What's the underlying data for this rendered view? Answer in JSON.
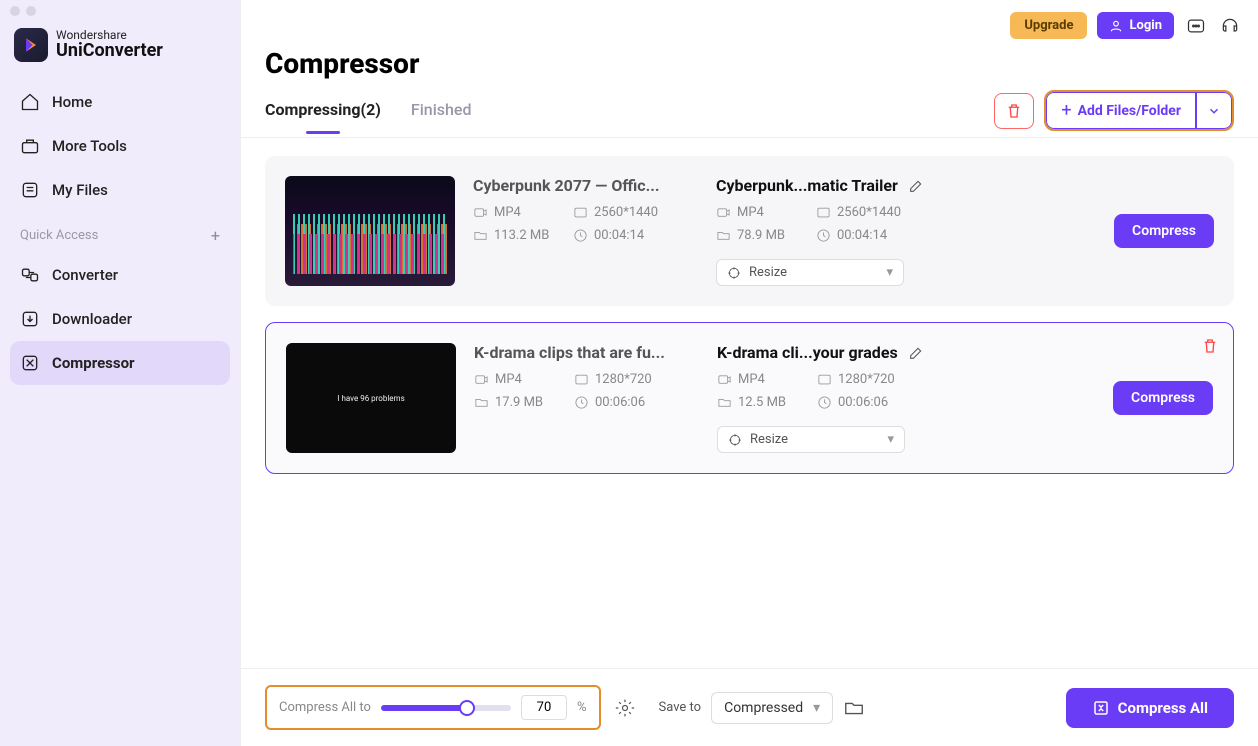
{
  "brand": {
    "top": "Wondershare",
    "name": "UniConverter"
  },
  "topbar": {
    "upgrade": "Upgrade",
    "login": "Login"
  },
  "sidebar": {
    "main": [
      {
        "label": "Home"
      },
      {
        "label": "More Tools"
      },
      {
        "label": "My Files"
      }
    ],
    "quick_label": "Quick Access",
    "quick": [
      {
        "label": "Converter"
      },
      {
        "label": "Downloader"
      },
      {
        "label": "Compressor"
      }
    ]
  },
  "page": {
    "title": "Compressor"
  },
  "tabs": {
    "active": "Compressing(2)",
    "inactive": "Finished"
  },
  "buttons": {
    "add": "Add Files/Folder",
    "compress": "Compress",
    "compress_all": "Compress All"
  },
  "files": [
    {
      "src_title": "Cyberpunk 2077 — Offic...",
      "src": {
        "format": "MP4",
        "res": "2560*1440",
        "size": "113.2 MB",
        "dur": "00:04:14"
      },
      "out_title": "Cyberpunk...matic Trailer",
      "out": {
        "format": "MP4",
        "res": "2560*1440",
        "size": "78.9 MB",
        "dur": "00:04:14"
      },
      "resize": "Resize",
      "thumb_text": ""
    },
    {
      "src_title": "K-drama clips that are fu...",
      "src": {
        "format": "MP4",
        "res": "1280*720",
        "size": "17.9 MB",
        "dur": "00:06:06"
      },
      "out_title": "K-drama cli...your grades",
      "out": {
        "format": "MP4",
        "res": "1280*720",
        "size": "12.5 MB",
        "dur": "00:06:06"
      },
      "resize": "Resize",
      "thumb_text": "I have 96 problems"
    }
  ],
  "bottom": {
    "compress_all_to": "Compress All to",
    "pct": "70",
    "pct_symbol": "%",
    "save_to": "Save to",
    "save_value": "Compressed"
  }
}
